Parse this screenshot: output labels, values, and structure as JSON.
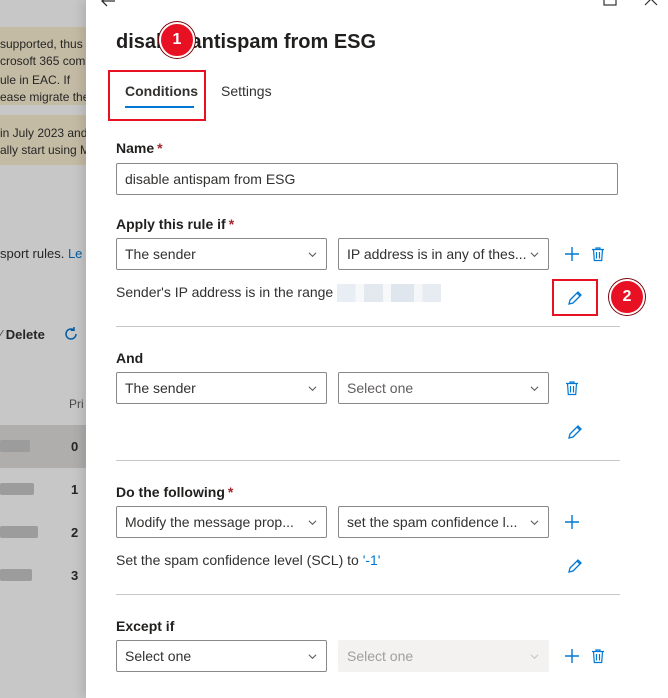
{
  "background": {
    "notice1_lines": [
      "supported, thus",
      "crosoft 365 com",
      "ule in EAC. If",
      "ease migrate the"
    ],
    "notice2_lines": [
      "in July 2023 and",
      "ally start using M"
    ],
    "transport_rules_text": "sport rules.",
    "transport_rules_link": "Le",
    "delete_label": "Delete",
    "priority_header": "Pri",
    "priorities": [
      "0",
      "1",
      "2",
      "3"
    ]
  },
  "panel": {
    "title": "disable antispam from ESG",
    "tabs": [
      {
        "label": "Conditions",
        "active": true
      },
      {
        "label": "Settings",
        "active": false
      }
    ],
    "name": {
      "label": "Name",
      "value": "disable antispam from ESG"
    },
    "apply_rule_if": {
      "label": "Apply this rule if",
      "condition_select": "The sender",
      "predicate_select": "IP address is in any of thes...",
      "description": "Sender's IP address is in the range"
    },
    "and": {
      "label": "And",
      "condition_select": "The sender",
      "predicate_select": "Select one"
    },
    "do_following": {
      "label": "Do the following",
      "action_select": "Modify the message prop...",
      "property_select": "set the spam confidence l...",
      "description_prefix": "Set the spam confidence level (SCL) to",
      "description_value": "'-1'"
    },
    "except_if": {
      "label": "Except if",
      "condition_select": "Select one",
      "predicate_select": "Select one"
    }
  },
  "callouts": [
    "1",
    "2"
  ],
  "colors": {
    "accent": "#0078d4",
    "required": "#a4262c",
    "callout": "#e81123"
  }
}
